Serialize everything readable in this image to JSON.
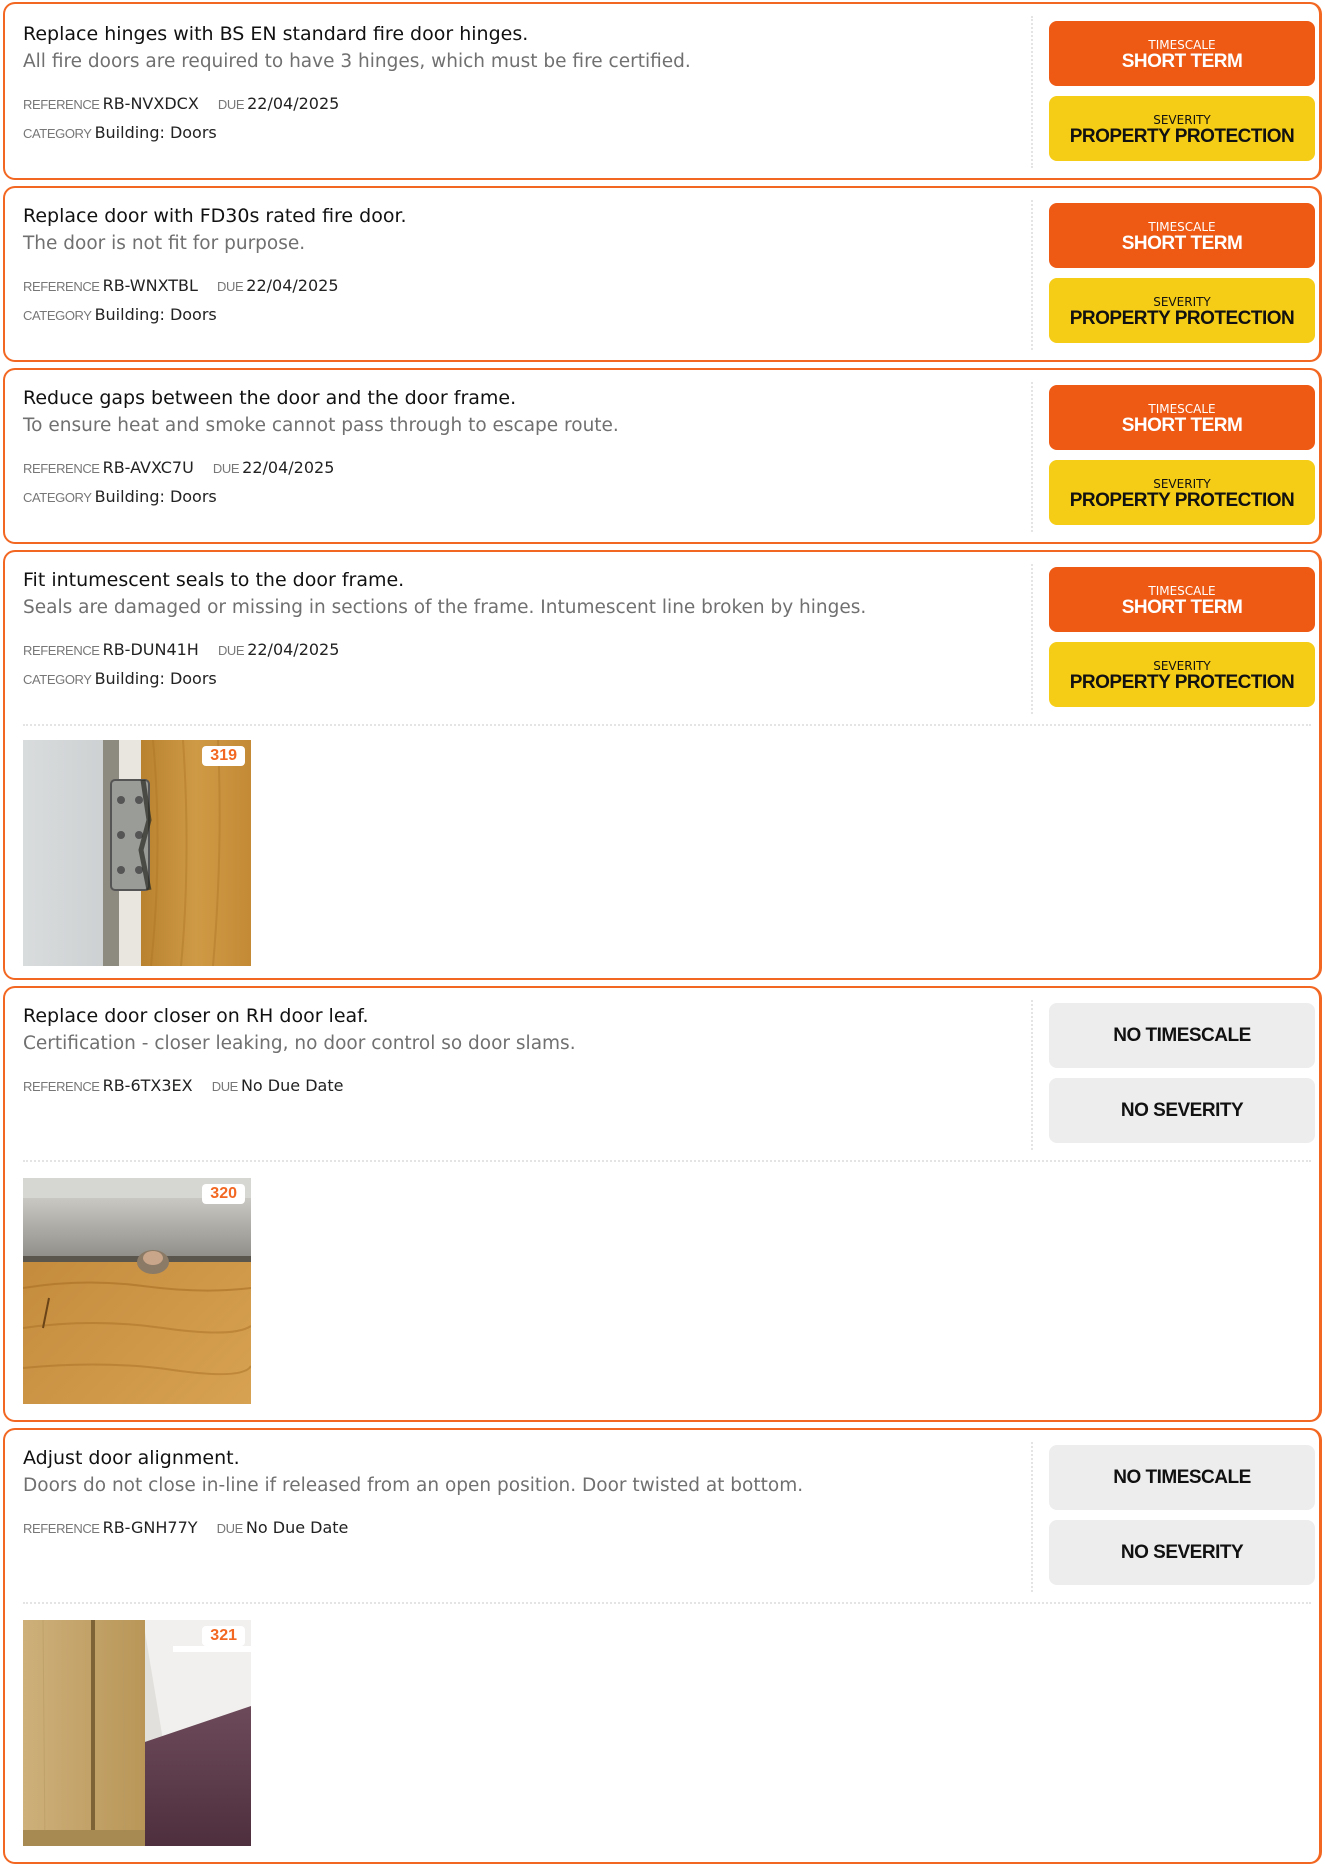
{
  "labels": {
    "reference": "REFERENCE",
    "due": "DUE",
    "category": "CATEGORY",
    "timescale": "TIMESCALE",
    "severity": "SEVERITY"
  },
  "actions": [
    {
      "title": "Replace hinges with BS EN standard fire door hinges.",
      "description": "All fire doors are required to have 3 hinges, which must be fire certified.",
      "reference": "RB-NVXDCX",
      "due": "22/04/2025",
      "category": "Building: Doors",
      "timescale": "SHORT TERM",
      "severity": "PROPERTY PROTECTION"
    },
    {
      "title": "Replace door with FD30s rated fire door.",
      "description": "The door is not fit for purpose.",
      "reference": "RB-WNXTBL",
      "due": "22/04/2025",
      "category": "Building: Doors",
      "timescale": "SHORT TERM",
      "severity": "PROPERTY PROTECTION"
    },
    {
      "title": "Reduce gaps between the door and the door frame.",
      "description": "To ensure heat and smoke cannot pass through to escape route.",
      "reference": "RB-AVXC7U",
      "due": "22/04/2025",
      "category": "Building: Doors",
      "timescale": "SHORT TERM",
      "severity": "PROPERTY PROTECTION"
    },
    {
      "title": "Fit intumescent seals to the door frame.",
      "description": "Seals are damaged or missing in sections of the frame. Intumescent line broken by hinges.",
      "reference": "RB-DUN41H",
      "due": "22/04/2025",
      "category": "Building: Doors",
      "timescale": "SHORT TERM",
      "severity": "PROPERTY PROTECTION",
      "photo_number": "319"
    },
    {
      "title": "Replace door closer on RH door leaf.",
      "description": "Certification  - closer leaking, no door control so door slams.",
      "reference": "RB-6TX3EX",
      "due": "No Due Date",
      "timescale": "NO TIMESCALE",
      "severity": "NO SEVERITY",
      "photo_number": "320"
    },
    {
      "title": "Adjust door alignment.",
      "description": "Doors do not close in-line if released from an open position. Door twisted at bottom.",
      "reference": "RB-GNH77Y",
      "due": "No Due Date",
      "timescale": "NO TIMESCALE",
      "severity": "NO SEVERITY",
      "photo_number": "321"
    }
  ],
  "colors": {
    "card_border": "#f26722",
    "timescale_short_term": "#ee5914",
    "severity_property_protection": "#f6cd16",
    "no_value_pill": "#ededed"
  }
}
